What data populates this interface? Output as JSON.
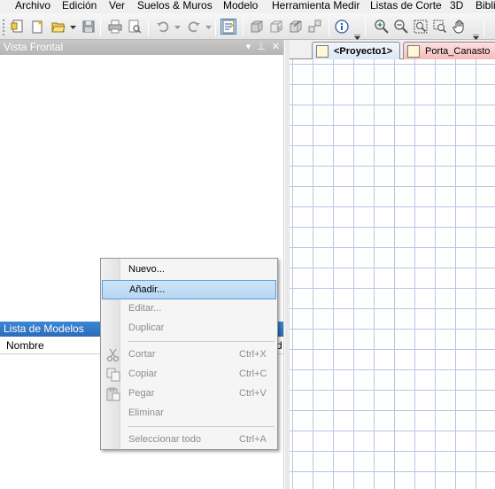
{
  "menubar": {
    "items": [
      "Archivo",
      "Edición",
      "Ver",
      "Suelos & Muros",
      "Modelo",
      "Herramienta Medir",
      "Listas de Corte",
      "3D",
      "Bibli"
    ]
  },
  "toolbar": {
    "icons": [
      "new-icon",
      "new-wizard-icon",
      "open-icon",
      "save-icon",
      "print-icon",
      "print-preview-icon",
      "undo-icon",
      "redo-icon",
      "properties-icon",
      "view-3d-icon",
      "view-3d-wire-icon",
      "view-3d-edit-icon",
      "info-icon",
      "zoom-in-icon",
      "zoom-out-icon",
      "zoom-extents-icon",
      "zoom-window-icon",
      "pan-hand-icon"
    ]
  },
  "left_panel": {
    "front_view_title": "Vista Frontal",
    "models_title": "Lista de Modelos",
    "column_name": "Nombre",
    "column_partial": "d"
  },
  "tabs": [
    {
      "label": "<Proyecto1>",
      "active": true
    },
    {
      "label": "Porta_Canasto",
      "active": false
    }
  ],
  "context_menu": {
    "items": [
      {
        "label": "Nuevo...",
        "shortcut": "",
        "enabled": true,
        "highlighted": false
      },
      {
        "label": "Añadir...",
        "shortcut": "",
        "enabled": true,
        "highlighted": true
      },
      {
        "label": "Editar...",
        "shortcut": "",
        "enabled": false,
        "highlighted": false
      },
      {
        "label": "Duplicar",
        "shortcut": "",
        "enabled": false,
        "highlighted": false
      },
      {
        "label": "Cortar",
        "shortcut": "Ctrl+X",
        "enabled": false,
        "highlighted": false
      },
      {
        "label": "Copiar",
        "shortcut": "Ctrl+C",
        "enabled": false,
        "highlighted": false
      },
      {
        "label": "Pegar",
        "shortcut": "Ctrl+V",
        "enabled": false,
        "highlighted": false
      },
      {
        "label": "Eliminar",
        "shortcut": "",
        "enabled": false,
        "highlighted": false
      },
      {
        "label": "Seleccionar todo",
        "shortcut": "Ctrl+A",
        "enabled": false,
        "highlighted": false
      }
    ]
  },
  "colors": {
    "active_title": "#2d6bb8",
    "grid_line": "#b6c7e4",
    "menu_highlight": "#b7d6f2"
  }
}
